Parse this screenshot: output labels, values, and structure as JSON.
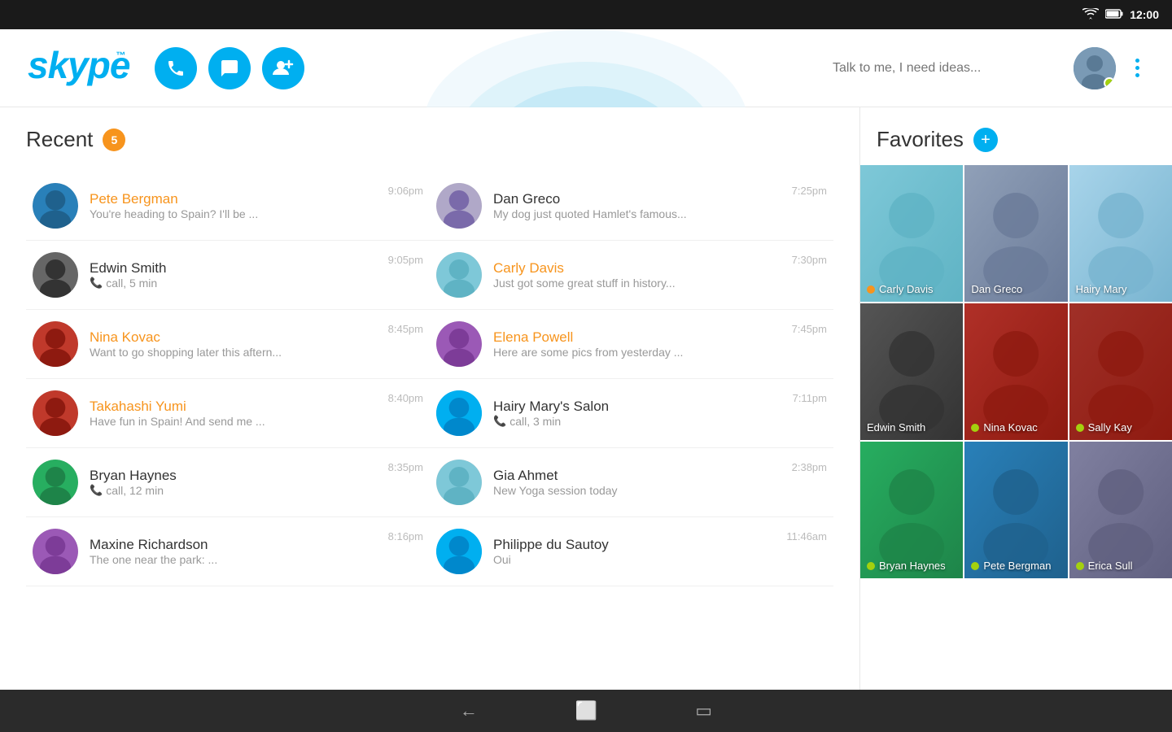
{
  "statusBar": {
    "time": "12:00",
    "wifi": "wifi",
    "battery": "battery"
  },
  "header": {
    "logo": "skype",
    "logoTM": "™",
    "callBtn": "📞",
    "chatBtn": "💬",
    "addBtn": "👤+",
    "searchPlaceholder": "Talk to me, I need ideas...",
    "moreMenuLabel": "more options"
  },
  "recent": {
    "title": "Recent",
    "badge": "5",
    "contacts": [
      {
        "id": "pete-bergman",
        "name": "Pete Bergman",
        "active": true,
        "preview": "You're heading to Spain? I'll be ...",
        "time": "9:06pm",
        "avatarStyle": "av-pete",
        "callIcon": false
      },
      {
        "id": "dan-greco",
        "name": "Dan Greco",
        "active": false,
        "preview": "My dog just quoted Hamlet's famous...",
        "time": "7:25pm",
        "avatarStyle": "av-dan",
        "callIcon": false
      },
      {
        "id": "edwin-smith",
        "name": "Edwin Smith",
        "active": false,
        "preview": "call, 5 min",
        "time": "9:05pm",
        "avatarStyle": "av-edwin",
        "callIcon": true
      },
      {
        "id": "carly-davis",
        "name": "Carly Davis",
        "active": true,
        "preview": "Just got some great stuff in history...",
        "time": "7:30pm",
        "avatarStyle": "av-carly",
        "callIcon": false
      },
      {
        "id": "nina-kovac",
        "name": "Nina Kovac",
        "active": true,
        "preview": "Want to go shopping later this aftern...",
        "time": "8:45pm",
        "avatarStyle": "av-nina",
        "callIcon": false
      },
      {
        "id": "elena-powell",
        "name": "Elena Powell",
        "active": true,
        "preview": "Here are some pics from yesterday ...",
        "time": "7:45pm",
        "avatarStyle": "av-erica",
        "callIcon": false
      },
      {
        "id": "takahashi-yumi",
        "name": "Takahashi Yumi",
        "active": true,
        "preview": "Have fun in Spain! And send me ...",
        "time": "8:40pm",
        "avatarStyle": "av-nina",
        "callIcon": false
      },
      {
        "id": "hairy-marys-salon",
        "name": "Hairy Mary's Salon",
        "active": false,
        "preview": "call, 3 min",
        "time": "7:11pm",
        "avatarStyle": "generic",
        "callIcon": true
      },
      {
        "id": "bryan-haynes",
        "name": "Bryan Haynes",
        "active": false,
        "preview": "call, 12 min",
        "time": "8:35pm",
        "avatarStyle": "av-bryan",
        "callIcon": true
      },
      {
        "id": "gia-ahmet",
        "name": "Gia Ahmet",
        "active": false,
        "preview": "New Yoga session today",
        "time": "2:38pm",
        "avatarStyle": "av-carly",
        "callIcon": false
      },
      {
        "id": "maxine-richardson",
        "name": "Maxine Richardson",
        "active": false,
        "preview": "The one near the park: ...",
        "time": "8:16pm",
        "avatarStyle": "av-erica",
        "callIcon": false
      },
      {
        "id": "philippe-du-sautoy",
        "name": "Philippe du Sautoy",
        "active": false,
        "preview": "Oui",
        "time": "11:46am",
        "avatarStyle": "generic",
        "callIcon": false
      }
    ]
  },
  "favorites": {
    "title": "Favorites",
    "addLabel": "+",
    "contacts": [
      {
        "id": "carly-davis-fav",
        "name": "Carly Davis",
        "hasOnline": true,
        "dotColor": "dot-yellow",
        "avatarStyle": "av-carly"
      },
      {
        "id": "dan-greco-fav",
        "name": "Dan Greco",
        "hasOnline": false,
        "dotColor": "",
        "avatarStyle": "av-dan"
      },
      {
        "id": "hairy-mary-fav",
        "name": "Hairy Mary",
        "hasOnline": false,
        "dotColor": "",
        "avatarStyle": "av-hairy"
      },
      {
        "id": "edwin-smith-fav",
        "name": "Edwin Smith",
        "hasOnline": false,
        "dotColor": "",
        "avatarStyle": "av-edwin"
      },
      {
        "id": "nina-kovac-fav",
        "name": "Nina Kovac",
        "hasOnline": true,
        "dotColor": "dot-green",
        "avatarStyle": "av-nina"
      },
      {
        "id": "sally-kay-fav",
        "name": "Sally Kay",
        "hasOnline": true,
        "dotColor": "dot-green",
        "avatarStyle": "av-sally"
      },
      {
        "id": "bryan-haynes-fav",
        "name": "Bryan Haynes",
        "hasOnline": true,
        "dotColor": "dot-green",
        "avatarStyle": "av-bryan"
      },
      {
        "id": "pete-bergman-fav",
        "name": "Pete Bergman",
        "hasOnline": true,
        "dotColor": "dot-green",
        "avatarStyle": "av-pete"
      },
      {
        "id": "erica-sull-fav",
        "name": "Erica Sull",
        "hasOnline": true,
        "dotColor": "dot-green",
        "avatarStyle": "av-erica"
      }
    ]
  },
  "navBar": {
    "backIcon": "←",
    "homeIcon": "⬜",
    "recentIcon": "▭"
  }
}
